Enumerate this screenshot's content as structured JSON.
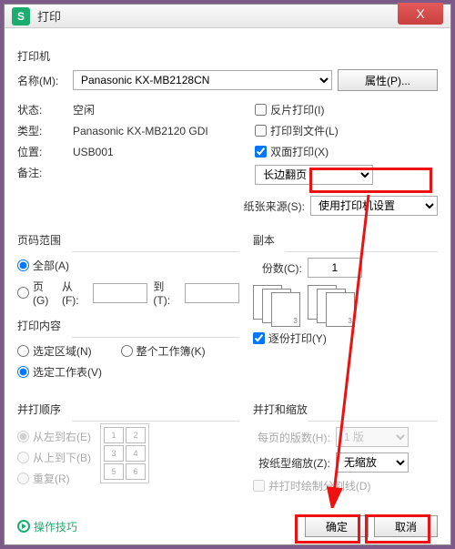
{
  "window": {
    "title": "打印",
    "close": "X",
    "icon_letter": "S"
  },
  "printer": {
    "section": "打印机",
    "name_label": "名称(M):",
    "name_value": "Panasonic KX-MB2128CN",
    "properties_btn": "属性(P)...",
    "status_label": "状态:",
    "status_value": "空闲",
    "type_label": "类型:",
    "type_value": "Panasonic KX-MB2120 GDI",
    "location_label": "位置:",
    "location_value": "USB001",
    "comment_label": "备注:",
    "reverse_print": "反片打印(I)",
    "print_to_file": "打印到文件(L)",
    "duplex": "双面打印(X)",
    "duplex_mode_value": "长边翻页",
    "paper_source_label": "纸张来源(S):",
    "paper_source_value": "使用打印机设置"
  },
  "range": {
    "section": "页码范围",
    "all": "全部(A)",
    "pages": "页(G)",
    "from_label": "从(F):",
    "to_label": "到(T):"
  },
  "copies": {
    "section": "副本",
    "count_label": "份数(C):",
    "count_value": "1",
    "collate": "逐份打印(Y)"
  },
  "content": {
    "section": "打印内容",
    "selection": "选定区域(N)",
    "workbook": "整个工作簿(K)",
    "sheet": "选定工作表(V)"
  },
  "order": {
    "section": "并打顺序",
    "lr": "从左到右(E)",
    "tb": "从上到下(B)",
    "repeat": "重复(R)"
  },
  "scale": {
    "section": "并打和缩放",
    "pps_label": "每页的版数(H):",
    "pps_value": "1 版",
    "zoom_label": "按纸型缩放(Z):",
    "zoom_value": "无缩放",
    "cutlines": "并打时绘制分割线(D)"
  },
  "footer": {
    "tips": "操作技巧",
    "ok": "确定",
    "cancel": "取消"
  },
  "keypad": [
    "1",
    "2",
    "3",
    "4",
    "5",
    "6"
  ]
}
